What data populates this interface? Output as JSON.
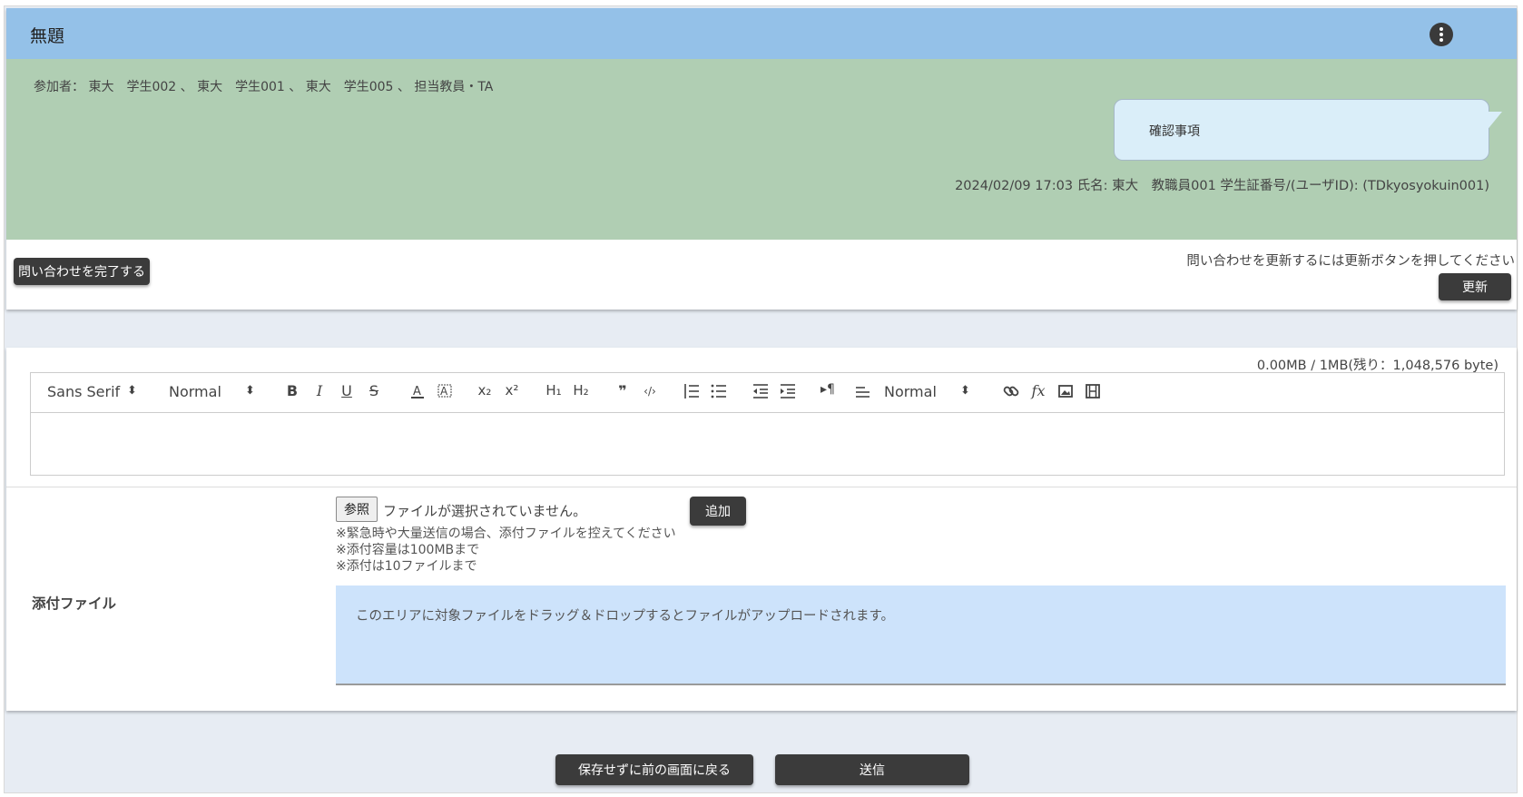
{
  "header": {
    "title": "無題",
    "more_icon": "more-vertical-icon"
  },
  "thread": {
    "participants": "参加者： 東大　学生002 、 東大　学生001 、 東大　学生005 、 担当教員・TA",
    "message": {
      "text": "確認事項",
      "meta": "2024/02/09 17:03 氏名: 東大　教職員001 学生証番号/(ユーザID): (TDkyosyokuin001)"
    }
  },
  "actions": {
    "complete_label": "問い合わせを完了する",
    "refresh_hint": "問い合わせを更新するには更新ボタンを押してください",
    "refresh_label": "更新"
  },
  "editor": {
    "capacity": "0.00MB / 1MB(残り：1,048,576 byte)",
    "font_select": "Sans Serif",
    "size_select": "Normal",
    "heading_select": "Normal",
    "buttons": {
      "bold": "B",
      "italic": "I",
      "underline": "U",
      "strike": "S",
      "subscript": "x₂",
      "superscript": "x²",
      "h1": "H₁",
      "h2": "H₂",
      "quote": "❞",
      "code": "‹/›",
      "formula": "fx"
    }
  },
  "attachment": {
    "label": "添付ファイル",
    "browse_label": "参照",
    "no_file": "ファイルが選択されていません。",
    "add_label": "追加",
    "notes": [
      "※緊急時や大量送信の場合、添付ファイルを控えてください",
      "※添付容量は100MBまで",
      "※添付は10ファイルまで"
    ],
    "drop_text": "このエリアに対象ファイルをドラッグ＆ドロップするとファイルがアップロードされます。"
  },
  "footer": {
    "back_label": "保存せずに前の画面に戻る",
    "send_label": "送信"
  },
  "colors": {
    "title_bar": "#94c1e8",
    "chat_bg": "#b0ceb3",
    "bubble": "#daeef9",
    "drop_zone": "#cde3fb",
    "dark_button": "#3b3b3b"
  }
}
